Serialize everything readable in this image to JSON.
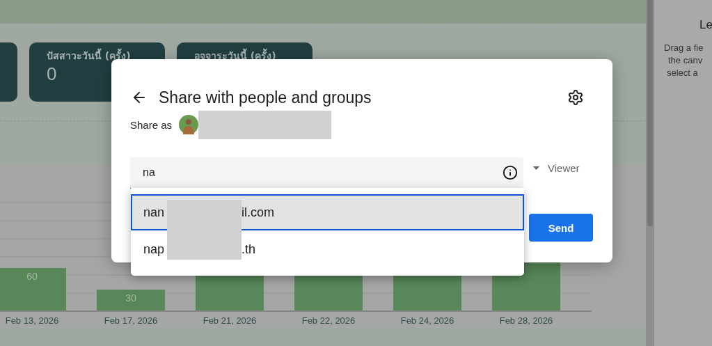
{
  "dashboard": {
    "cards": [
      {
        "kind": "partial"
      },
      {
        "kind": "stat",
        "title": "ปัสสาวะวันนี้ (ครั้ง)",
        "value": "0"
      },
      {
        "kind": "stat",
        "title": "อจจาระวันนี้ (ครั้ง)"
      }
    ],
    "chart": {
      "bars": [
        {
          "date": "Feb 13, 2026",
          "label": "60"
        },
        {
          "date": "Feb 17, 2026",
          "label": "30"
        },
        {
          "date": "Feb 21, 2026"
        },
        {
          "date": "Feb 22, 2026"
        },
        {
          "date": "Feb 24, 2026"
        },
        {
          "date": "Feb 28, 2026"
        }
      ]
    }
  },
  "side_panel": {
    "title": "Le",
    "hint_lines": [
      "Drag a fie",
      "the canv",
      "select a"
    ]
  },
  "dialog": {
    "title": "Share with people and groups",
    "share_as_label": "Share as",
    "input": {
      "value": "na"
    },
    "role": "Viewer",
    "send": "Send",
    "suggestions": [
      {
        "text_start": "nan",
        "text_end": "il.com",
        "selected": true
      },
      {
        "text_start": "nap",
        "text_end": ".th",
        "selected": false
      }
    ]
  }
}
